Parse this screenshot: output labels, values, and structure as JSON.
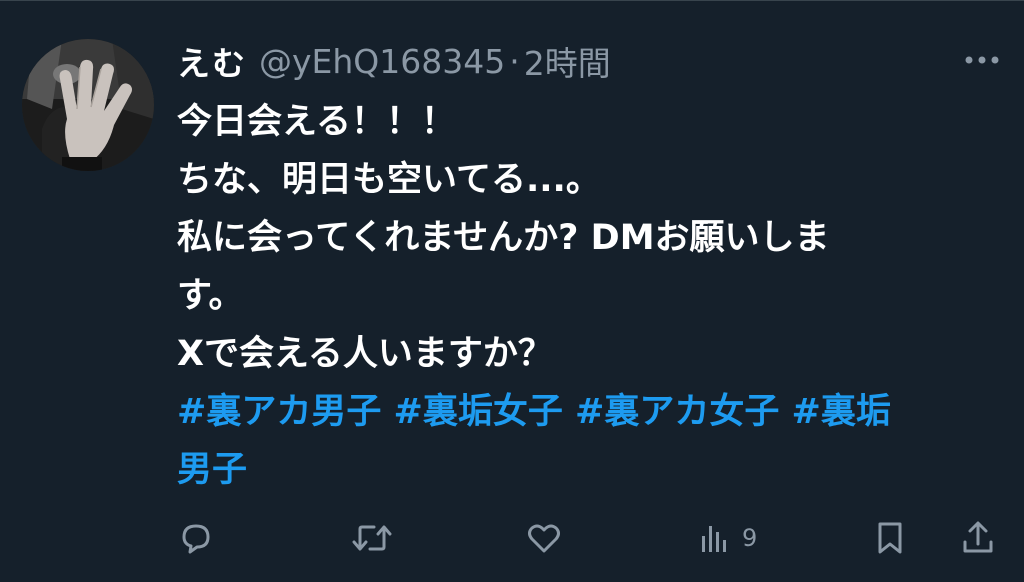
{
  "user": {
    "display_name": "えむ",
    "handle": "@yEhQ168345",
    "separator": "·",
    "time": "2時間"
  },
  "tweet": {
    "lines": [
      "今日会える！！！",
      "ちな、明日も空いてる...。",
      "私に会ってくれませんか?  DMお願いしま",
      "す。",
      "Xで会える人いますか？"
    ],
    "hashtags": [
      "#裏アカ男子",
      "#裏垢女子",
      "#裏アカ女子",
      "#裏垢"
    ],
    "hashtag_continuation": "男子"
  },
  "actions": {
    "views_count": "9"
  },
  "icons": {
    "more": "more-dots-icon",
    "reply": "reply-bubble-icon",
    "retweet": "retweet-icon",
    "like": "heart-icon",
    "views": "views-bar-chart-icon",
    "bookmark": "bookmark-icon",
    "share": "share-upload-icon"
  },
  "colors": {
    "background": "#15202b",
    "text": "#ffffff",
    "muted": "#8b98a5",
    "link": "#1d9bf0"
  }
}
